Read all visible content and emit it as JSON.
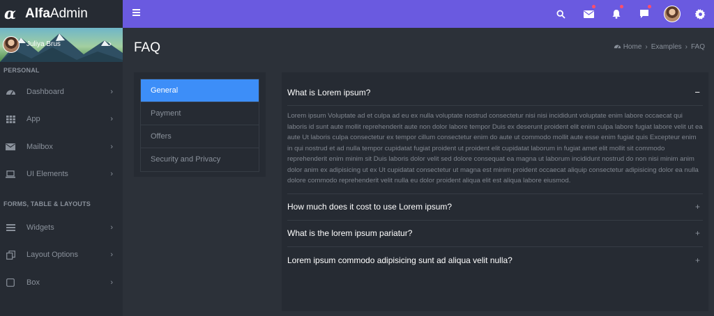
{
  "brand": {
    "mark": "α",
    "name_bold": "Alfa",
    "name_light": "Admin"
  },
  "topbar": {
    "icons": [
      "search-icon",
      "mail-icon",
      "bell-icon",
      "chat-icon",
      "avatar",
      "gear-icon"
    ]
  },
  "sidebar": {
    "user_name": "Juliya Brus",
    "section1": "PERSONAL",
    "section2": "FORMS, TABLE & LAYOUTS",
    "items": [
      {
        "label": "Dashboard",
        "icon": "dashboard-icon"
      },
      {
        "label": "App",
        "icon": "grid-icon"
      },
      {
        "label": "Mailbox",
        "icon": "envelope-icon"
      },
      {
        "label": "UI Elements",
        "icon": "laptop-icon"
      },
      {
        "label": "Widgets",
        "icon": "bars-icon"
      },
      {
        "label": "Layout Options",
        "icon": "copy-icon"
      },
      {
        "label": "Box",
        "icon": "square-icon"
      }
    ]
  },
  "page": {
    "title": "FAQ",
    "breadcrumb": [
      "Home",
      "Examples",
      "FAQ"
    ]
  },
  "faq_menu": {
    "items": [
      "General",
      "Payment",
      "Offers",
      "Security and Privacy"
    ],
    "active": "General"
  },
  "faq": {
    "items": [
      {
        "question": "What is Lorem ipsum?",
        "expanded": true,
        "answer": "Lorem ipsum Voluptate ad et culpa ad eu ex nulla voluptate nostrud consectetur nisi nisi incididunt voluptate enim labore occaecat qui laboris id sunt aute mollit reprehenderit aute non dolor labore tempor Duis ex deserunt proident elit enim culpa labore fugiat labore velit ut ea aute Ut laboris culpa consectetur ex tempor cillum consectetur enim do aute ut commodo mollit aute esse enim fugiat quis Excepteur enim in qui nostrud et ad nulla tempor cupidatat fugiat proident ut proident elit cupidatat laborum in fugiat amet elit mollit sit commodo reprehenderit enim minim sit Duis laboris dolor velit sed dolore consequat ea magna ut laborum incididunt nostrud do non nisi minim anim dolor anim ex adipisicing ut ex Ut cupidatat consectetur ut magna est minim proident occaecat aliquip consectetur adipisicing dolor ea nulla dolore commodo reprehenderit velit nulla eu dolor proident aliqua elit est aliqua labore eiusmod."
      },
      {
        "question": "How much does it cost to use Lorem ipsum?",
        "expanded": false
      },
      {
        "question": "What is the lorem ipsum pariatur?",
        "expanded": false
      },
      {
        "question": "Lorem ipsum commodo adipisicing sunt ad aliqua velit nulla?",
        "expanded": false
      }
    ]
  },
  "colors": {
    "topbar": "#6a5ae0",
    "active_menu": "#3d8ef8",
    "sidebar": "#262b33",
    "content_bg": "#2c3139",
    "badge": "#ff4d6a"
  }
}
